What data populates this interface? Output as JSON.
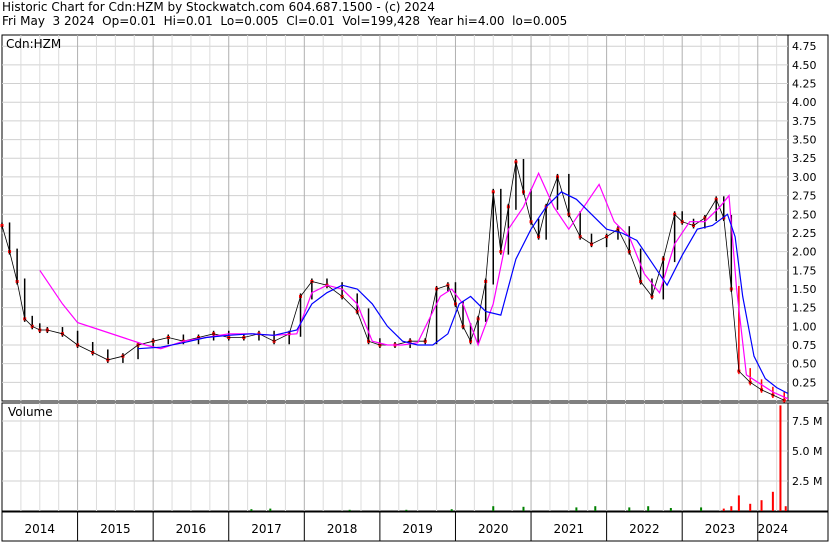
{
  "header": {
    "line1": "Historic Chart for Cdn:HZM by Stockwatch.com 604.687.1500 - (c) 2024",
    "line2": "Fri May  3 2024  Op=0.01  Hi=0.01  Lo=0.005  Cl=0.01  Vol=199,428  Year hi=4.00  lo=0.005"
  },
  "colors": {
    "price_bar": "#000000",
    "volume_bar": "#008000",
    "moving_average_short": "#ff00ff",
    "moving_average_long": "#0000ff",
    "recent_bars": "#ff0000"
  },
  "chart_data": [
    {
      "type": "line",
      "panel": "price",
      "label": "Cdn:HZM",
      "y_ticks": [
        "4.75",
        "4.50",
        "4.25",
        "4.00",
        "3.75",
        "3.50",
        "3.25",
        "3.00",
        "2.75",
        "2.50",
        "2.25",
        "2.00",
        "1.75",
        "1.50",
        "1.25",
        "1.00",
        "0.75",
        "0.50",
        "0.25"
      ],
      "ylim": [
        0,
        4.9
      ],
      "grid": true,
      "x_ticks": [
        "2014",
        "2015",
        "2016",
        "2017",
        "2018",
        "2019",
        "2020",
        "2021",
        "2022",
        "2023",
        "2024"
      ],
      "xlim": [
        2014.0,
        2024.4
      ],
      "series": [
        {
          "style": "price",
          "x": [
            2014.0,
            2014.1,
            2014.2,
            2014.3,
            2014.4,
            2014.5,
            2014.6,
            2014.8,
            2015.0,
            2015.2,
            2015.4,
            2015.6,
            2015.8,
            2016.0,
            2016.2,
            2016.4,
            2016.6,
            2016.8,
            2017.0,
            2017.2,
            2017.4,
            2017.6,
            2017.8,
            2017.95,
            2018.1,
            2018.3,
            2018.5,
            2018.7,
            2018.85,
            2019.0,
            2019.2,
            2019.4,
            2019.6,
            2019.75,
            2019.9,
            2020.0,
            2020.1,
            2020.2,
            2020.3,
            2020.4,
            2020.5,
            2020.6,
            2020.7,
            2020.8,
            2020.9,
            2021.0,
            2021.1,
            2021.2,
            2021.35,
            2021.5,
            2021.65,
            2021.8,
            2022.0,
            2022.15,
            2022.3,
            2022.45,
            2022.6,
            2022.75,
            2022.9,
            2023.0,
            2023.15,
            2023.3,
            2023.45,
            2023.55,
            2023.65,
            2023.75,
            2023.9,
            2024.05,
            2024.2,
            2024.35
          ],
          "y": [
            2.35,
            2.0,
            1.6,
            1.1,
            1.0,
            0.95,
            0.95,
            0.9,
            0.75,
            0.65,
            0.55,
            0.6,
            0.75,
            0.8,
            0.85,
            0.8,
            0.85,
            0.9,
            0.85,
            0.85,
            0.9,
            0.8,
            0.9,
            1.4,
            1.6,
            1.55,
            1.4,
            1.2,
            0.8,
            0.75,
            0.75,
            0.8,
            0.8,
            1.5,
            1.55,
            1.3,
            1.0,
            0.8,
            1.1,
            1.6,
            2.8,
            2.0,
            2.6,
            3.2,
            2.8,
            2.4,
            2.2,
            2.6,
            3.0,
            2.5,
            2.2,
            2.1,
            2.2,
            2.3,
            2.0,
            1.6,
            1.4,
            1.9,
            2.5,
            2.4,
            2.35,
            2.45,
            2.7,
            2.45,
            1.5,
            0.4,
            0.25,
            0.15,
            0.08,
            0.01
          ]
        },
        {
          "style": "ma_short",
          "x": [
            2014.5,
            2014.8,
            2015.0,
            2015.3,
            2015.6,
            2015.9,
            2016.1,
            2016.4,
            2016.7,
            2017.0,
            2017.3,
            2017.6,
            2017.9,
            2018.1,
            2018.3,
            2018.5,
            2018.7,
            2018.9,
            2019.1,
            2019.3,
            2019.5,
            2019.8,
            2019.95,
            2020.1,
            2020.3,
            2020.5,
            2020.7,
            2020.9,
            2021.1,
            2021.3,
            2021.5,
            2021.7,
            2021.9,
            2022.1,
            2022.3,
            2022.5,
            2022.7,
            2022.9,
            2023.1,
            2023.3,
            2023.5,
            2023.62,
            2023.72,
            2023.85,
            2024.0,
            2024.2,
            2024.4
          ],
          "y": [
            1.75,
            1.3,
            1.05,
            0.95,
            0.85,
            0.75,
            0.7,
            0.8,
            0.85,
            0.9,
            0.9,
            0.88,
            0.9,
            1.45,
            1.55,
            1.5,
            1.3,
            0.8,
            0.75,
            0.75,
            0.78,
            1.4,
            1.5,
            1.3,
            0.75,
            1.3,
            2.3,
            2.6,
            3.05,
            2.6,
            2.3,
            2.6,
            2.9,
            2.4,
            2.2,
            1.7,
            1.45,
            2.1,
            2.4,
            2.4,
            2.6,
            2.75,
            1.5,
            0.35,
            0.25,
            0.12,
            0.03
          ]
        },
        {
          "style": "ma_long",
          "x": [
            2015.8,
            2016.1,
            2016.4,
            2016.7,
            2017.0,
            2017.3,
            2017.6,
            2017.9,
            2018.1,
            2018.3,
            2018.5,
            2018.7,
            2018.9,
            2019.1,
            2019.3,
            2019.5,
            2019.7,
            2019.9,
            2020.05,
            2020.2,
            2020.4,
            2020.6,
            2020.8,
            2021.0,
            2021.2,
            2021.4,
            2021.6,
            2021.8,
            2022.0,
            2022.2,
            2022.4,
            2022.6,
            2022.8,
            2023.0,
            2023.2,
            2023.4,
            2023.6,
            2023.7,
            2023.8,
            2023.95,
            2024.1,
            2024.25,
            2024.4
          ],
          "y": [
            0.7,
            0.72,
            0.78,
            0.85,
            0.88,
            0.9,
            0.88,
            0.95,
            1.3,
            1.45,
            1.55,
            1.5,
            1.3,
            1.0,
            0.8,
            0.75,
            0.75,
            0.9,
            1.3,
            1.4,
            1.2,
            1.15,
            1.9,
            2.3,
            2.6,
            2.8,
            2.7,
            2.5,
            2.3,
            2.25,
            2.15,
            1.85,
            1.55,
            1.95,
            2.3,
            2.35,
            2.5,
            2.2,
            1.4,
            0.6,
            0.3,
            0.18,
            0.1
          ]
        }
      ]
    },
    {
      "type": "bar",
      "panel": "volume",
      "label": "Volume",
      "y_ticks": [
        "7.5 M",
        "5.0 M",
        "2.5 M"
      ],
      "ylim": [
        0,
        9.0
      ],
      "grid": true,
      "x_ticks": [
        "2014",
        "2015",
        "2016",
        "2017",
        "2018",
        "2019",
        "2020",
        "2021",
        "2022",
        "2023",
        "2024"
      ],
      "xlim": [
        2014.0,
        2024.4
      ],
      "x": [
        2017.3,
        2017.55,
        2018.6,
        2019.35,
        2019.95,
        2020.5,
        2020.9,
        2021.6,
        2021.85,
        2022.3,
        2022.55,
        2022.85,
        2023.25,
        2023.55,
        2023.65,
        2023.75,
        2023.9,
        2024.05,
        2024.2,
        2024.3,
        2024.37
      ],
      "values": [
        0.15,
        0.2,
        0.1,
        0.1,
        0.15,
        0.4,
        0.35,
        0.3,
        0.4,
        0.3,
        0.4,
        0.25,
        0.3,
        0.2,
        0.4,
        1.3,
        0.6,
        0.9,
        1.6,
        8.8,
        0.4
      ]
    }
  ]
}
